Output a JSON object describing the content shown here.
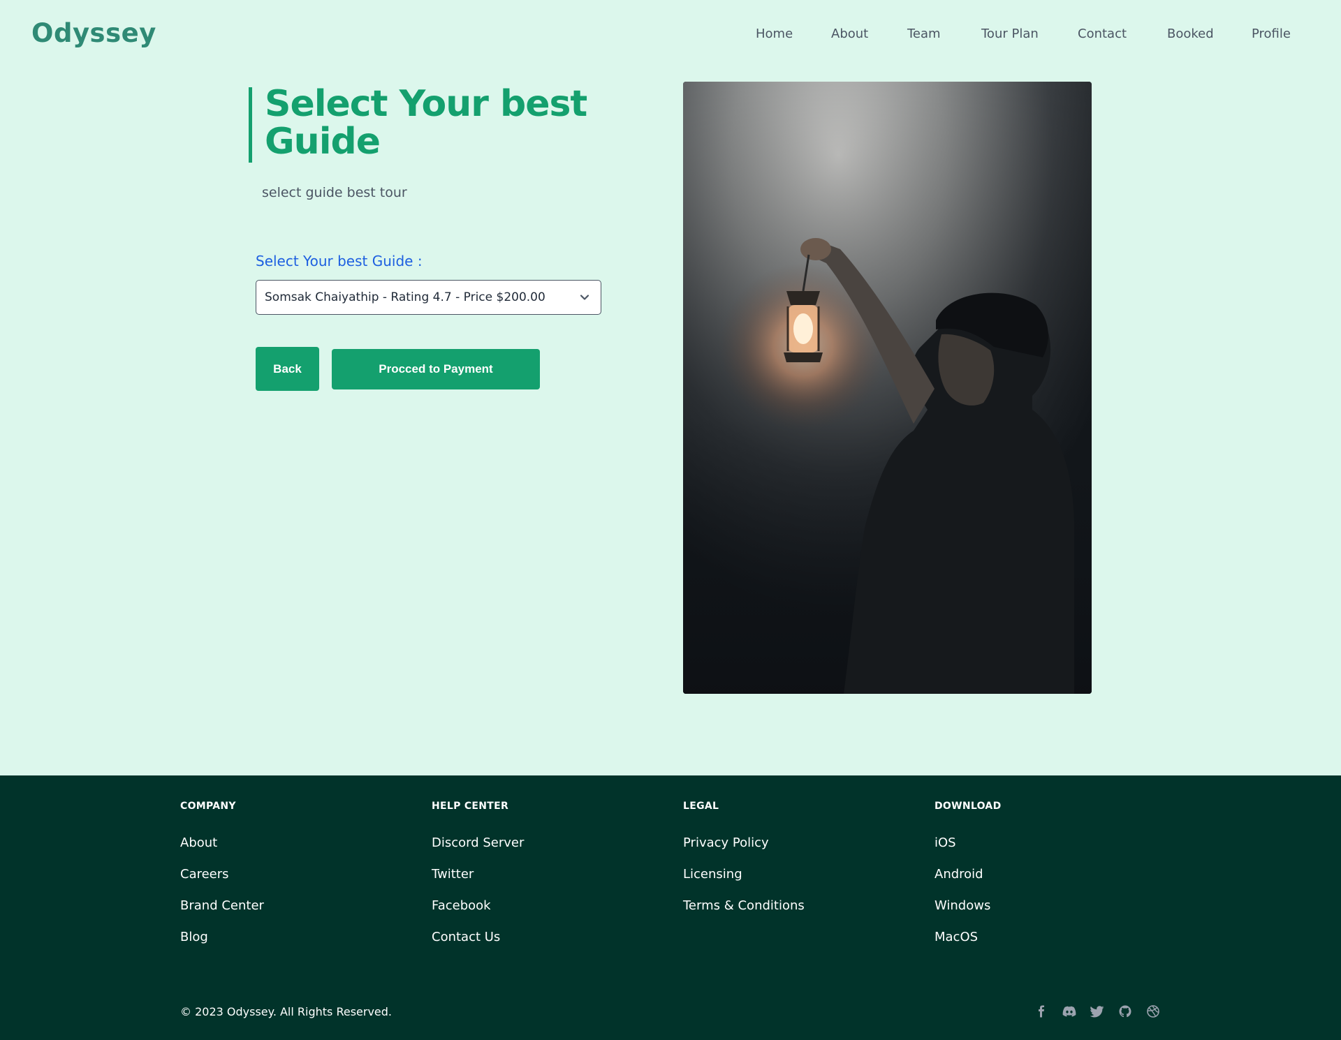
{
  "header": {
    "logo": "Odyssey",
    "nav": [
      "Home",
      "About",
      "Team",
      "Tour Plan",
      "Contact",
      "Booked",
      "Profile"
    ]
  },
  "main": {
    "title": "Select Your best Guide",
    "subtitle": "select guide best tour",
    "select_label": "Select Your best Guide :",
    "selected_guide": "Somsak Chaiyathip - Rating 4.7 - Price $200.00",
    "back_label": "Back",
    "payment_label": "Procced to Payment"
  },
  "footer": {
    "columns": [
      {
        "heading": "COMPANY",
        "links": [
          "About",
          "Careers",
          "Brand Center",
          "Blog"
        ]
      },
      {
        "heading": "HELP CENTER",
        "links": [
          "Discord Server",
          "Twitter",
          "Facebook",
          "Contact Us"
        ]
      },
      {
        "heading": "LEGAL",
        "links": [
          "Privacy Policy",
          "Licensing",
          "Terms & Conditions"
        ]
      },
      {
        "heading": "DOWNLOAD",
        "links": [
          "iOS",
          "Android",
          "Windows",
          "MacOS"
        ]
      }
    ],
    "copyright": "© 2023 Odyssey. All Rights Reserved.",
    "socials": [
      "facebook-icon",
      "discord-icon",
      "twitter-icon",
      "github-icon",
      "dribbble-icon"
    ]
  },
  "colors": {
    "background": "#dcf7ec",
    "accent": "#14a06e",
    "logo": "#2f8a75",
    "footer": "#01332a",
    "label_blue": "#1d5fe0"
  }
}
